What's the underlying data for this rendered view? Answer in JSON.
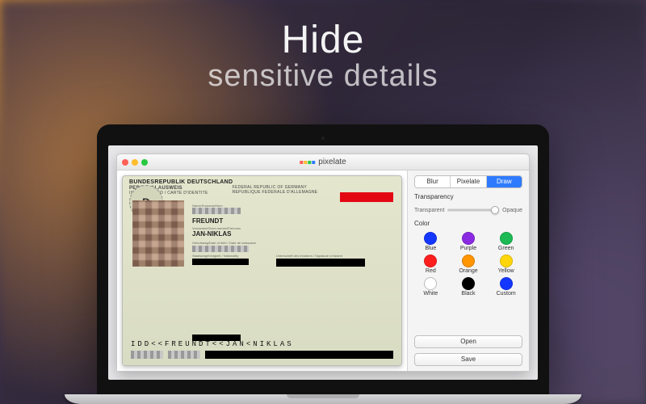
{
  "headline": {
    "line1": "Hide",
    "line2": "sensitive details"
  },
  "app": {
    "title": "pixelate",
    "logo_colors": [
      "#ff5f57",
      "#ffbd2e",
      "#28c940",
      "#2f7bff"
    ]
  },
  "card": {
    "country_line": "BUNDESREPUBLIK DEUTSCHLAND",
    "country_sub1": "FEDERAL REPUBLIC OF GERMANY",
    "country_sub2": "REPUBLIQUE FEDERALE D'ALLEMAGNE",
    "doc_type": "PERSONALAUSWEIS",
    "doc_type_sub": "IDENTITY CARD / CARTE D'IDENTITE",
    "flag_letter": "D",
    "name_label": "Name/Surname/Nom",
    "surname": "FREUNDT",
    "given_label": "Vornamen/Given names/Prénoms",
    "given": "JAN-NIKLAS",
    "dob_label": "Geburtstag/Date of birth / Date de naissance",
    "nat_label": "Staatsangehörigkeit / Nationality",
    "sig_label": "Unterschrift des Inhabers / Signature of bearer",
    "mrz1": "IDD<<FREUNDT<<JAN<NIKLAS"
  },
  "tools": {
    "tabs": [
      "Blur",
      "Pixelate",
      "Draw"
    ],
    "active_tab": 2,
    "transparency_label": "Transparency",
    "slider_left": "Transparent",
    "slider_right": "Opaque",
    "slider_value": 0.92,
    "color_label": "Color",
    "colors": [
      {
        "name": "Blue",
        "hex": "#1437ff"
      },
      {
        "name": "Purple",
        "hex": "#8a2be2"
      },
      {
        "name": "Green",
        "hex": "#1db954"
      },
      {
        "name": "Red",
        "hex": "#ff1e1e"
      },
      {
        "name": "Orange",
        "hex": "#ff9500"
      },
      {
        "name": "Yellow",
        "hex": "#ffd60a"
      },
      {
        "name": "White",
        "hex": "#ffffff"
      },
      {
        "name": "Black",
        "hex": "#000000"
      },
      {
        "name": "Custom",
        "hex": "#1437ff"
      }
    ],
    "open_label": "Open",
    "save_label": "Save"
  }
}
